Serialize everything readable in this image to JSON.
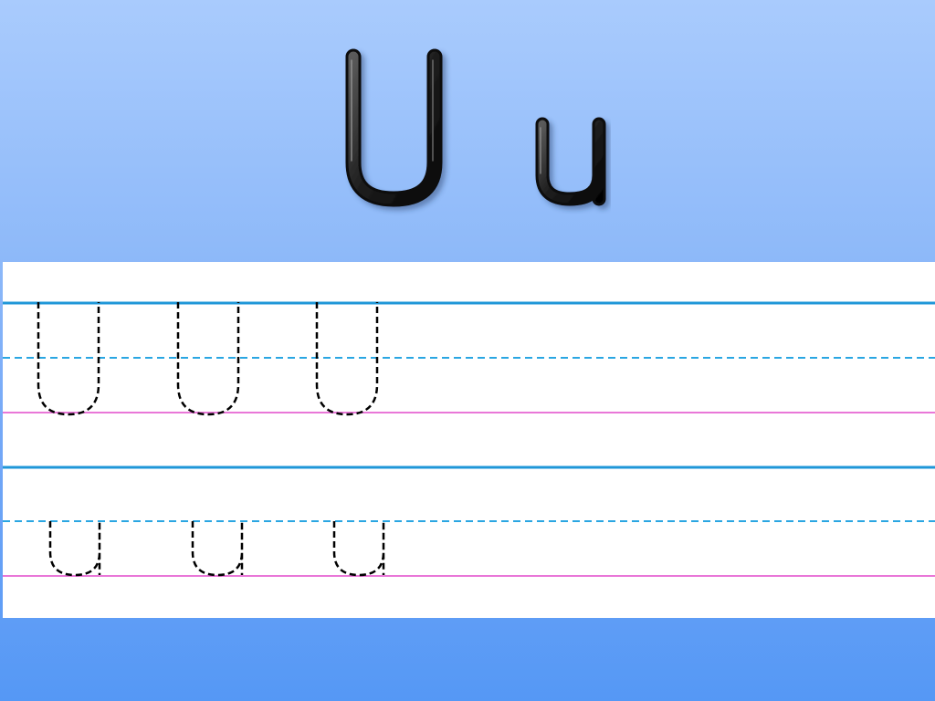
{
  "slide": {
    "letter": "U",
    "uppercase": "U",
    "lowercase": "u"
  },
  "colors": {
    "background_top": "#a9cbfd",
    "background_bottom": "#5598f5",
    "sheet": "#ffffff",
    "top_line": "#1f97d8",
    "mid_dashed_line": "#2aa6e2",
    "baseline": "#e977d8",
    "trace_stroke": "#000000",
    "glyph_fill": "#1e1e1e",
    "glyph_highlight": "#8a8a8a"
  },
  "practice_rows": [
    {
      "case": "uppercase",
      "letter": "U",
      "trace_count": 3
    },
    {
      "case": "lowercase",
      "letter": "u",
      "trace_count": 3
    }
  ]
}
